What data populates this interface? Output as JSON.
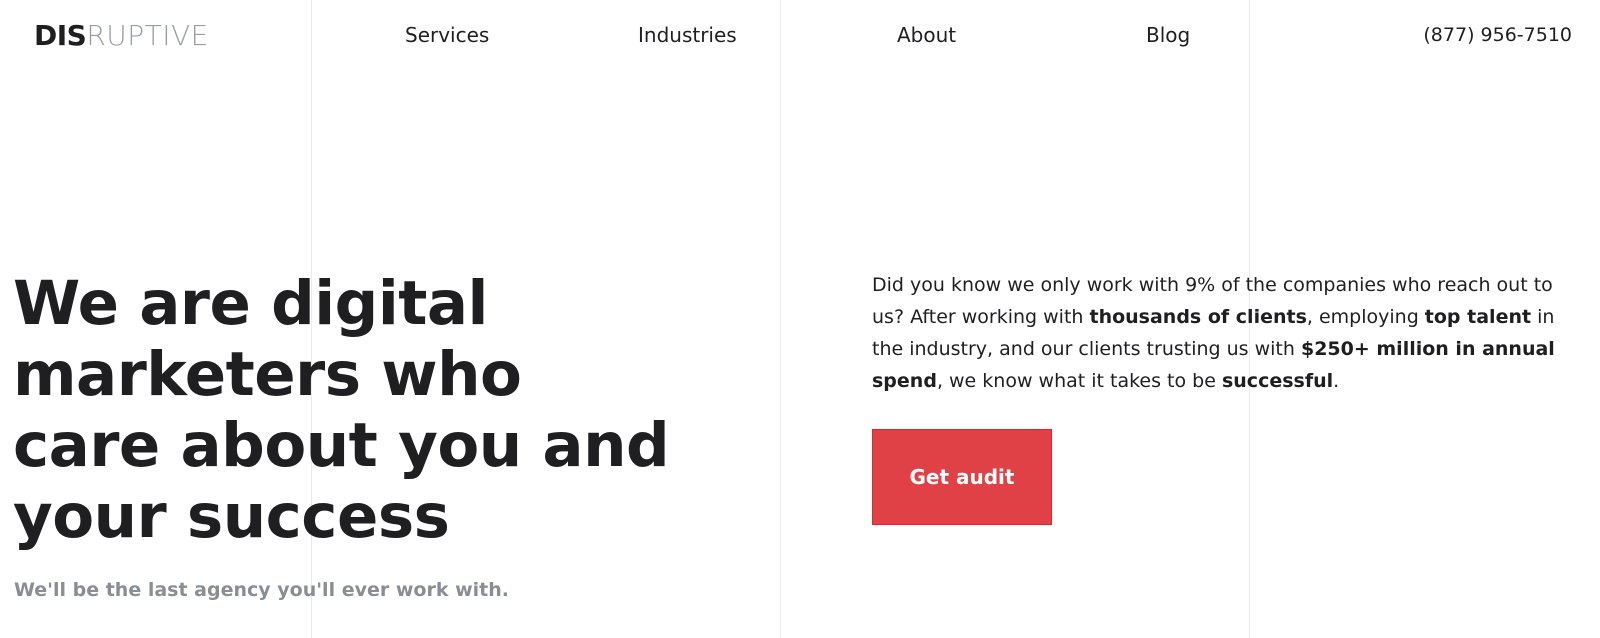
{
  "header": {
    "logo_strong": "DIS",
    "logo_light": "RUPTIVE",
    "nav": [
      {
        "label": "Services"
      },
      {
        "label": "Industries"
      },
      {
        "label": "About"
      },
      {
        "label": "Blog"
      }
    ],
    "phone": "(877) 956-7510"
  },
  "hero": {
    "heading_lines": [
      "We are digital",
      "marketers who",
      "care about you and",
      "your success"
    ],
    "subheading": "We'll be the last agency you'll ever work with.",
    "paragraph": {
      "p1": "Did you know we only work with 9% of the companies who reach out to us? After working with ",
      "b1": "thousands of clients",
      "p2": ", employing ",
      "b2": "top talent",
      "p3": " in the industry, and our clients trusting us with ",
      "b3": "$250+ million in annual spend",
      "p4": ", we know what it takes to be ",
      "b4": "successful",
      "p5": "."
    },
    "cta_label": "Get audit"
  },
  "colors": {
    "accent": "#e04147",
    "text": "#1f1f22",
    "muted": "#8a8e94",
    "gridline": "#ebebed"
  }
}
